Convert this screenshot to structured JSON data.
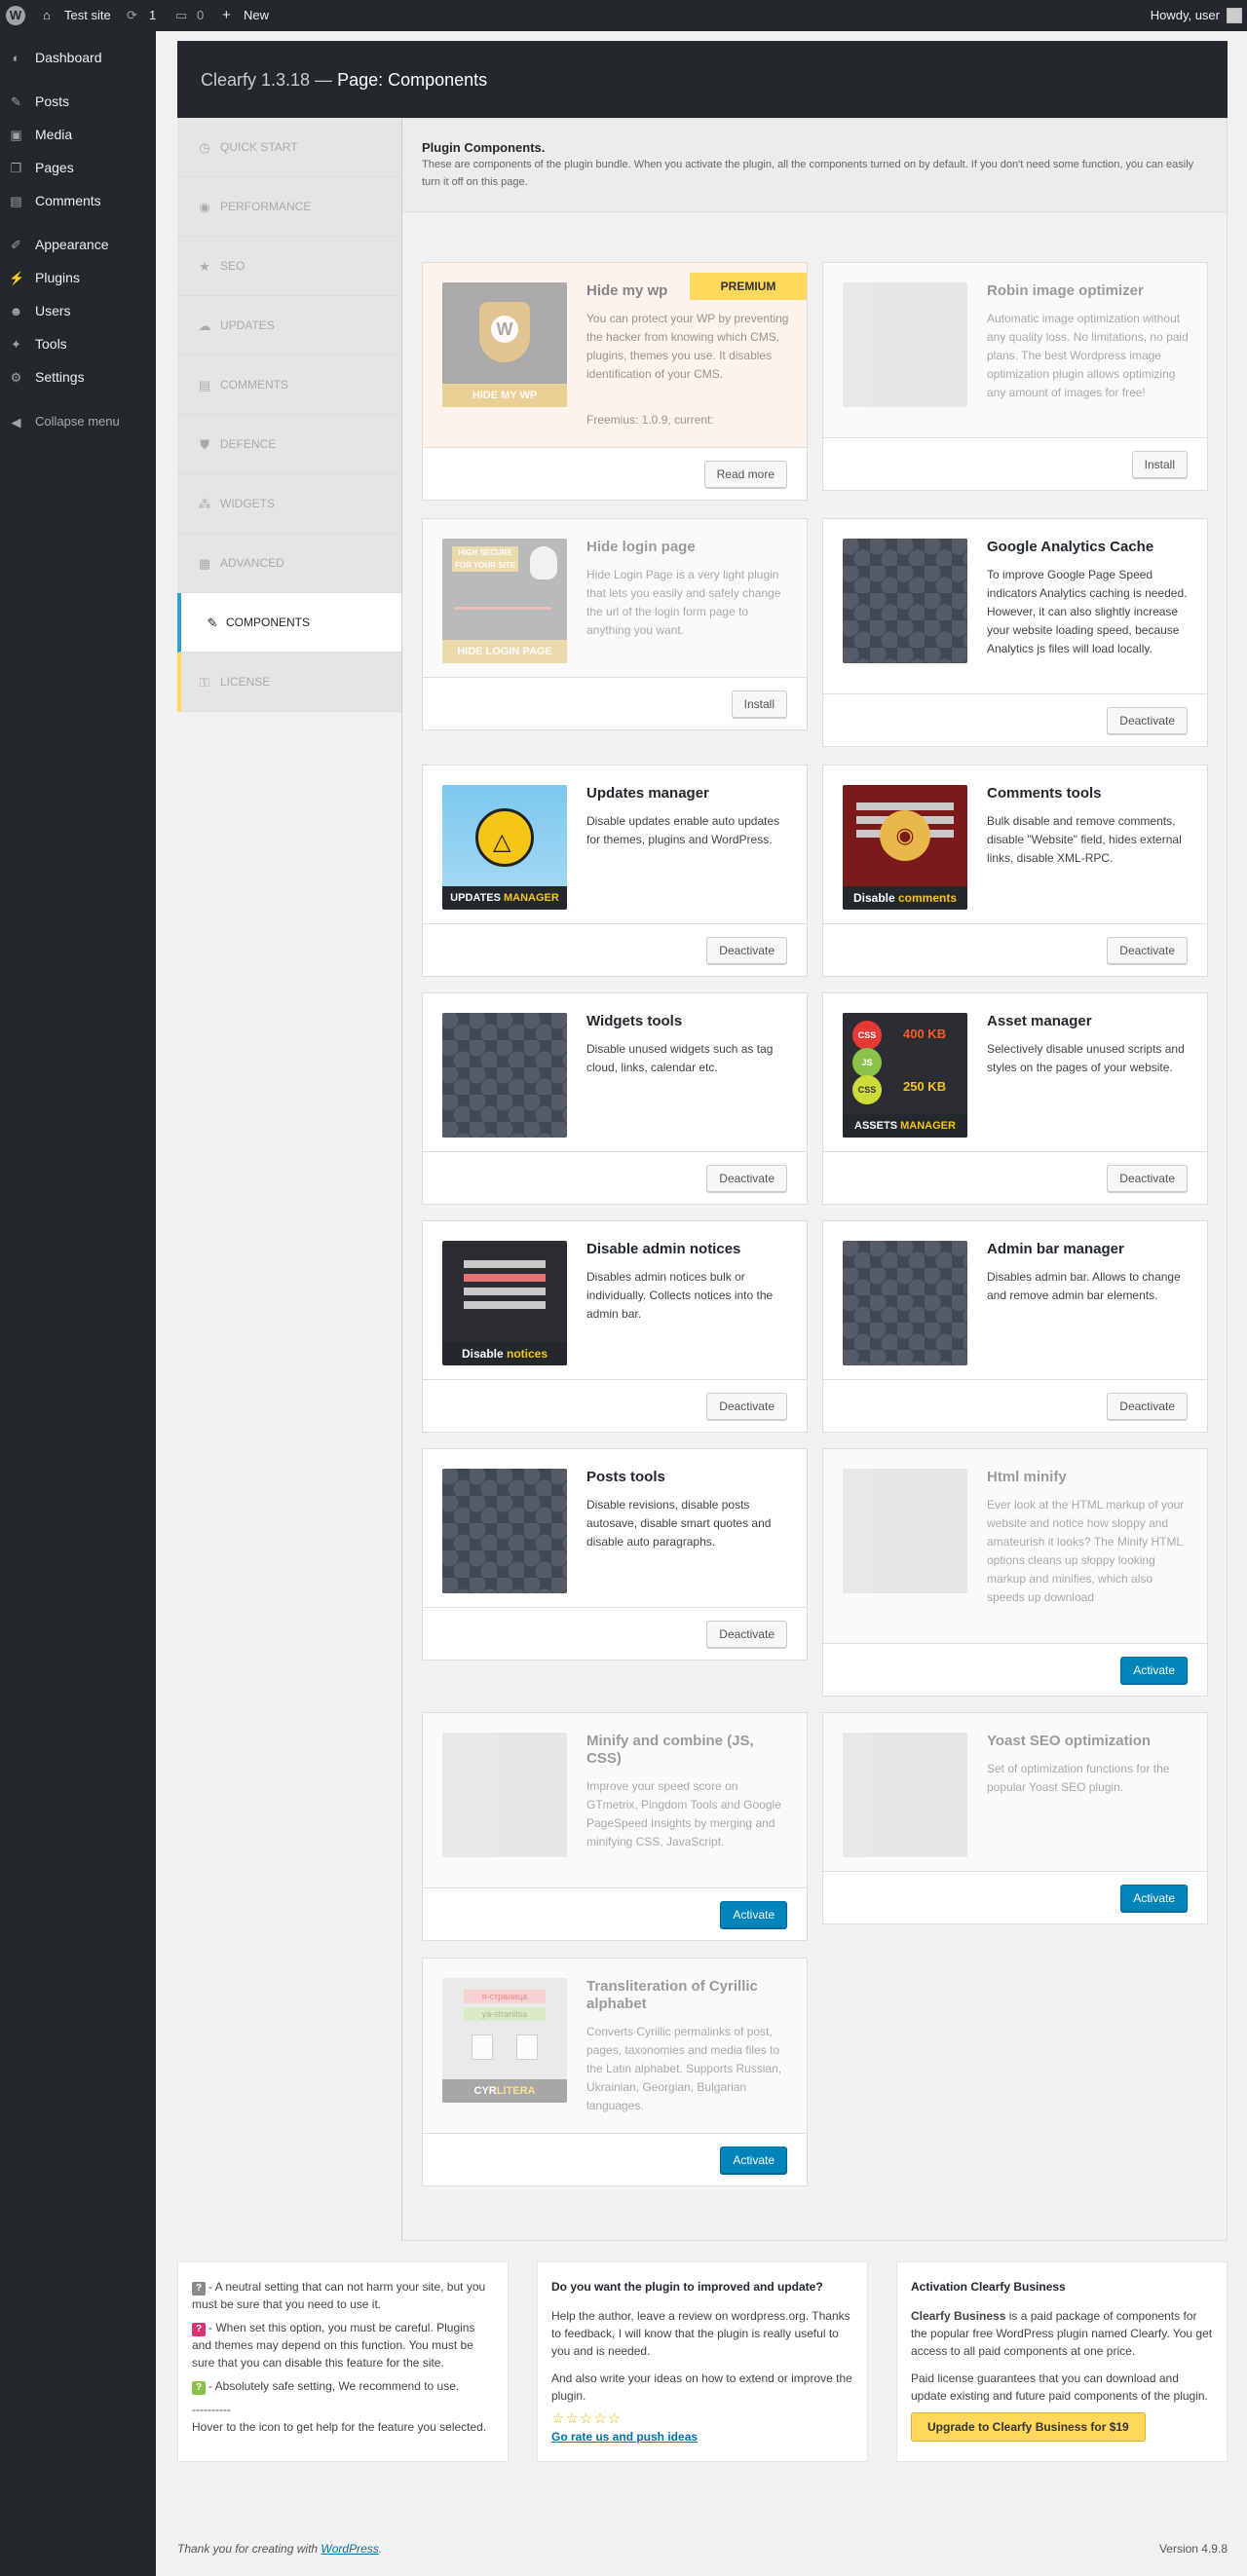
{
  "adminbar": {
    "site": "Test site",
    "updates": "1",
    "comments": "0",
    "new": "New",
    "howdy": "Howdy, user"
  },
  "menu": [
    {
      "label": "Dashboard",
      "icon": "dashboard-icon",
      "glyph": "◐"
    },
    {
      "label": "Posts",
      "icon": "pin-icon",
      "glyph": "✎"
    },
    {
      "label": "Media",
      "icon": "media-icon",
      "glyph": "▣"
    },
    {
      "label": "Pages",
      "icon": "pages-icon",
      "glyph": "❐"
    },
    {
      "label": "Comments",
      "icon": "comments-icon",
      "glyph": "▤"
    },
    {
      "label": "Appearance",
      "icon": "brush-icon",
      "glyph": "✐"
    },
    {
      "label": "Plugins",
      "icon": "plugin-icon",
      "glyph": "⚡"
    },
    {
      "label": "Users",
      "icon": "users-icon",
      "glyph": "☻"
    },
    {
      "label": "Tools",
      "icon": "wrench-icon",
      "glyph": "✦"
    },
    {
      "label": "Settings",
      "icon": "settings-icon",
      "glyph": "⚙"
    },
    {
      "label": "Collapse menu",
      "icon": "collapse-icon",
      "glyph": "◀"
    }
  ],
  "header": {
    "title": "Clearfy 1.3.18 —",
    "subtitle": "Page: Components"
  },
  "nav": [
    {
      "label": "QUICK START",
      "glyph": "◷"
    },
    {
      "label": "PERFORMANCE",
      "glyph": "◉"
    },
    {
      "label": "SEO",
      "glyph": "★"
    },
    {
      "label": "UPDATES",
      "glyph": "☁"
    },
    {
      "label": "COMMENTS",
      "glyph": "▤"
    },
    {
      "label": "DEFENCE",
      "glyph": "⛊"
    },
    {
      "label": "WIDGETS",
      "glyph": "⁂"
    },
    {
      "label": "ADVANCED",
      "glyph": "▦"
    },
    {
      "label": "COMPONENTS",
      "glyph": "✎"
    },
    {
      "label": "LICENSE",
      "glyph": "⚿"
    }
  ],
  "intro": {
    "title": "Plugin Components.",
    "desc": "These are components of the plugin bundle. When you activate the plugin, all the components turned on by default. If you don't need some function, you can easily turn it off on this page."
  },
  "cards": [
    {
      "title": "Hide my wp",
      "desc": "You can protect your WP by preventing the hacker from knowing which CMS, plugins, themes you use. It disables identification of your CMS.",
      "extra": "Freemius: 1.0.9, current:",
      "button": "Read more",
      "badge": "PREMIUM",
      "thumb_caption": "HIDE MY WP"
    },
    {
      "title": "Robin image optimizer",
      "desc": "Automatic image optimization without any quality loss. No limitations, no paid plans. The best Wordpress image optimization plugin allows optimizing any amount of images for free!",
      "button": "Install"
    },
    {
      "title": "Hide login page",
      "desc": "Hide Login Page is a very light plugin that lets you easily and safely change the url of the login form page to anything you want.",
      "button": "Install",
      "thumb_caption": "HIDE LOGIN PAGE",
      "thumb_top": "HIGH SECURE FOR YOUR SITE"
    },
    {
      "title": "Google Analytics Cache",
      "desc": "To improve Google Page Speed indicators Analytics caching is needed. However, it can also slightly increase your website loading speed, because Analytics js files will load locally.",
      "button": "Deactivate"
    },
    {
      "title": "Updates manager",
      "desc": "Disable updates enable auto updates for themes, plugins and WordPress.",
      "button": "Deactivate",
      "thumb_caption_a": "UPDATES",
      "thumb_caption_b": "MANAGER"
    },
    {
      "title": "Comments tools",
      "desc": "Bulk disable and remove comments, disable \"Website\" field, hides external links, disable XML-RPC.",
      "button": "Deactivate",
      "thumb_caption_a": "Disable",
      "thumb_caption_b": "comments"
    },
    {
      "title": "Widgets tools",
      "desc": "Disable unused widgets such as tag cloud, links, calendar etc.",
      "button": "Deactivate"
    },
    {
      "title": "Asset manager",
      "desc": "Selectively disable unused scripts and styles on the pages of your website.",
      "button": "Deactivate",
      "thumb_caption_a": "ASSETS",
      "thumb_caption_b": "MANAGER",
      "kb1": "400 KB",
      "kb2": "250 KB",
      "css": "CSS",
      "js": "JS"
    },
    {
      "title": "Disable admin notices",
      "desc": "Disables admin notices bulk or individually. Collects notices into the admin bar.",
      "button": "Deactivate",
      "thumb_caption_a": "Disable",
      "thumb_caption_b": "notices"
    },
    {
      "title": "Admin bar manager",
      "desc": "Disables admin bar. Allows to change and remove admin bar elements.",
      "button": "Deactivate"
    },
    {
      "title": "Posts tools",
      "desc": "Disable revisions, disable posts autosave, disable smart quotes and disable auto paragraphs.",
      "button": "Deactivate"
    },
    {
      "title": "Html minify",
      "desc": "Ever look at the HTML markup of your website and notice how sloppy and amateurish it looks? The Minify HTML options cleans up sloppy looking markup and minifies, which also speeds up download",
      "button": "Activate"
    },
    {
      "title": "Minify and combine (JS, CSS)",
      "desc": "Improve your speed score on GTmetrix, Pingdom Tools and Google PageSpeed Insights by merging and minifying CSS, JavaScript.",
      "button": "Activate"
    },
    {
      "title": "Yoast SEO optimization",
      "desc": "Set of optimization functions for the popular Yoast SEO plugin.",
      "button": "Activate"
    },
    {
      "title": "Transliteration of Cyrillic alphabet",
      "desc": "Converts Cyrillic permalinks of post, pages, taxonomies and media files to the Latin alphabet. Supports Russian, Ukrainian, Georgian, Bulgarian languages.",
      "button": "Activate",
      "thumb_caption_a": "CYR",
      "thumb_caption_b": "LITERA",
      "tl1": "я-страница",
      "tl2": "ya-stranitsa"
    }
  ],
  "help": {
    "neutral": "- A neutral setting that can not harm your site, but you must be sure that you need to use it.",
    "careful": "- When set this option, you must be careful. Plugins and themes may depend on this function. You must be sure that you can disable this feature for the site.",
    "safe": "- Absolutely safe setting, We recommend to use.",
    "sep": "----------",
    "hover": "Hover to the icon to get help for the feature you selected.",
    "colors": {
      "neutral": "#8a8a8a",
      "careful": "#dd3073",
      "safe": "#8bc34a"
    }
  },
  "review": {
    "title": "Do you want the plugin to improved and update?",
    "p1": "Help the author, leave a review on wordpress.org. Thanks to feedback, I will know that the plugin is really useful to you and is needed.",
    "p2": "And also write your ideas on how to extend or improve the plugin.",
    "stars": "☆☆☆☆☆",
    "link": "Go rate us and push ideas"
  },
  "business": {
    "title": "Activation Clearfy Business",
    "p1_bold": "Clearfy Business",
    "p1": " is a paid package of components for the popular free WordPress plugin named Clearfy. You get access to all paid components at one price.",
    "p2": "Paid license guarantees that you can download and update existing and future paid components of the plugin.",
    "button": "Upgrade to Clearfy Business for $19"
  },
  "footer": {
    "thanks": "Thank you for creating with ",
    "wp": "WordPress",
    "dot": ".",
    "version": "Version 4.9.8"
  }
}
